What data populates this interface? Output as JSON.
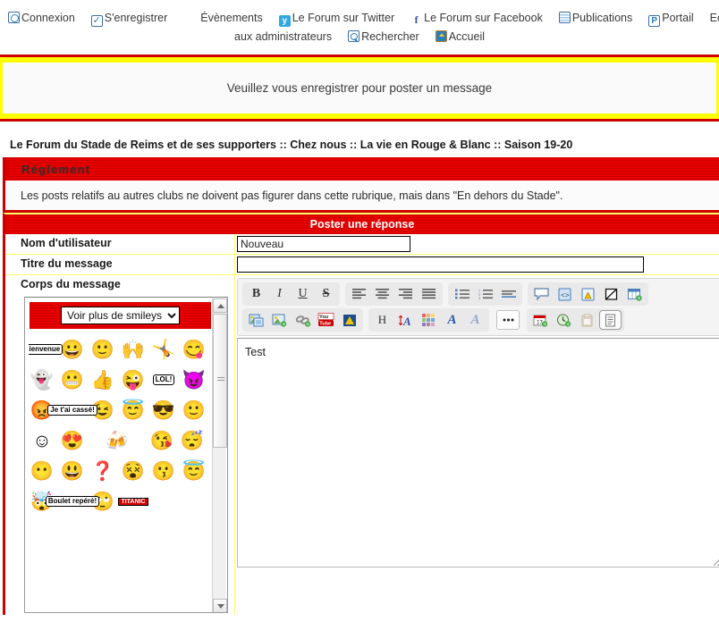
{
  "topnav": {
    "line1": [
      {
        "label": "Connexion",
        "icon": "login-icon"
      },
      {
        "label": "S'enregistrer",
        "icon": "register-check-icon"
      },
      {
        "label": "Évènements",
        "icon": "none"
      },
      {
        "label": "Le Forum sur Twitter",
        "icon": "twitter-icon"
      },
      {
        "label": "Le Forum sur Facebook",
        "icon": "facebook-icon"
      },
      {
        "label": "Publications",
        "icon": "publications-icon"
      },
      {
        "label": "Portail",
        "icon": "portal-icon"
      },
      {
        "label": "Ecrivez",
        "icon": "none"
      }
    ],
    "line2": [
      {
        "label": "aux administrateurs",
        "icon": "none"
      },
      {
        "label": "Rechercher",
        "icon": "search-icon"
      },
      {
        "label": "Accueil",
        "icon": "home-icon"
      }
    ]
  },
  "notice": {
    "text": "Veuillez vous enregistrer pour poster un message"
  },
  "breadcrumb": {
    "text": "Le Forum du Stade de Reims et de ses supporters  :: Chez nous :: La vie en Rouge & Blanc :: Saison 19-20"
  },
  "reglement": {
    "title": "Règlement",
    "body": "Les posts relatifs au autres clubs ne doivent pas figurer dans cette rubrique, mais dans \"En dehors du Stade\"."
  },
  "form": {
    "title": "Poster une réponse",
    "username_label": "Nom d'utilisateur",
    "username_value": "Nouveau",
    "subject_label": "Titre du message",
    "subject_value": "",
    "body_label": "Corps du message",
    "message_text": "Test"
  },
  "smileys": {
    "select_value": "Voir plus de smileys",
    "select_options": [
      "Voir plus de smileys"
    ],
    "items": [
      {
        "name": "smiley-bienvenue-sign",
        "glyph": "Bienvenue",
        "kind": "sign"
      },
      {
        "name": "smiley-wave",
        "glyph": "😀"
      },
      {
        "name": "smiley-happy",
        "glyph": "🙂"
      },
      {
        "name": "smiley-cheer",
        "glyph": "🙌"
      },
      {
        "name": "smiley-jump",
        "glyph": "🤸"
      },
      {
        "name": "smiley-tongue",
        "glyph": "😋"
      },
      {
        "name": "smiley-ghost",
        "glyph": "👻"
      },
      {
        "name": "smiley-teeth",
        "glyph": "😬"
      },
      {
        "name": "smiley-thumbsup",
        "glyph": "👍"
      },
      {
        "name": "smiley-wink-yellow",
        "glyph": "😜"
      },
      {
        "name": "smiley-lol-sign",
        "glyph": "LOL!",
        "kind": "sign"
      },
      {
        "name": "smiley-devil",
        "glyph": "😈"
      },
      {
        "name": "smiley-red-face",
        "glyph": "😡"
      },
      {
        "name": "smiley-jetaicasse-sign",
        "glyph": "Je t'ai cassé!",
        "kind": "sign"
      },
      {
        "name": "smiley-wink",
        "glyph": "😉"
      },
      {
        "name": "smiley-angel",
        "glyph": "😇"
      },
      {
        "name": "smiley-cool",
        "glyph": "😎"
      },
      {
        "name": "smiley-plain",
        "glyph": "🙂"
      },
      {
        "name": "smiley-shy",
        "glyph": "☺"
      },
      {
        "name": "smiley-heart-eyes",
        "glyph": "😍"
      },
      {
        "name": "smiley-three-at-table",
        "glyph": "🍻",
        "kind": "wide"
      },
      {
        "name": "smiley-love-pink",
        "glyph": "😘"
      },
      {
        "name": "smiley-sleep",
        "glyph": "😴"
      },
      {
        "name": "smiley-zip",
        "glyph": "😶"
      },
      {
        "name": "smiley-grin",
        "glyph": "😃"
      },
      {
        "name": "smiley-question",
        "glyph": "❓"
      },
      {
        "name": "smiley-punch",
        "glyph": "😵"
      },
      {
        "name": "smiley-kiss",
        "glyph": "😗"
      },
      {
        "name": "smiley-halo",
        "glyph": "😇"
      },
      {
        "name": "smiley-explode",
        "glyph": "🤯"
      },
      {
        "name": "smiley-boulet-sign",
        "glyph": "Boulet repéré!",
        "kind": "sign"
      },
      {
        "name": "smiley-point",
        "glyph": "🙄"
      },
      {
        "name": "smiley-titanic",
        "glyph": "TITANIC",
        "kind": "titanic"
      }
    ]
  },
  "toolbar": {
    "row1": [
      {
        "group": 1,
        "name": "bold-icon",
        "label": "B"
      },
      {
        "group": 1,
        "name": "italic-icon",
        "label": "I"
      },
      {
        "group": 1,
        "name": "underline-icon",
        "label": "U"
      },
      {
        "group": 1,
        "name": "strikethrough-icon",
        "label": "S"
      },
      {
        "group": 2,
        "name": "align-left-icon",
        "label": ""
      },
      {
        "group": 2,
        "name": "align-center-icon",
        "label": ""
      },
      {
        "group": 2,
        "name": "align-right-icon",
        "label": ""
      },
      {
        "group": 2,
        "name": "align-justify-icon",
        "label": ""
      },
      {
        "group": 3,
        "name": "unordered-list-icon",
        "label": ""
      },
      {
        "group": 3,
        "name": "ordered-list-icon",
        "label": ""
      },
      {
        "group": 3,
        "name": "indent-icon",
        "label": ""
      },
      {
        "group": 4,
        "name": "quote-icon",
        "label": ""
      },
      {
        "group": 4,
        "name": "code-icon",
        "label": ""
      },
      {
        "group": 4,
        "name": "spoiler-icon",
        "label": ""
      },
      {
        "group": 4,
        "name": "hidden-text-icon",
        "label": ""
      },
      {
        "group": 4,
        "name": "insert-table-icon",
        "label": ""
      }
    ],
    "row2": [
      {
        "group": 1,
        "name": "insert-image-icon",
        "label": ""
      },
      {
        "group": 1,
        "name": "add-image-icon",
        "label": ""
      },
      {
        "group": 1,
        "name": "insert-link-icon",
        "label": ""
      },
      {
        "group": 1,
        "name": "youtube-icon",
        "label": "You Tube"
      },
      {
        "group": 1,
        "name": "dailymotion-icon",
        "label": ""
      },
      {
        "group": 2,
        "name": "heading-icon",
        "label": "H"
      },
      {
        "group": 2,
        "name": "font-size-icon",
        "label": "A"
      },
      {
        "group": 2,
        "name": "font-color-icon",
        "label": ""
      },
      {
        "group": 2,
        "name": "font-family-icon",
        "label": "A"
      },
      {
        "group": 2,
        "name": "remove-format-icon",
        "label": "A"
      },
      {
        "group": 3,
        "name": "more-options-icon",
        "label": "..."
      },
      {
        "group": 4,
        "name": "insert-date-icon",
        "label": "17"
      },
      {
        "group": 4,
        "name": "insert-time-icon",
        "label": ""
      },
      {
        "group": 4,
        "name": "paste-icon",
        "label": ""
      },
      {
        "group": 4,
        "name": "source-view-icon",
        "label": ""
      }
    ]
  },
  "colors": {
    "red": "#e60000",
    "dark_red": "#cc0000",
    "yellow": "#ffff00",
    "light_yellow": "#ffff66"
  }
}
